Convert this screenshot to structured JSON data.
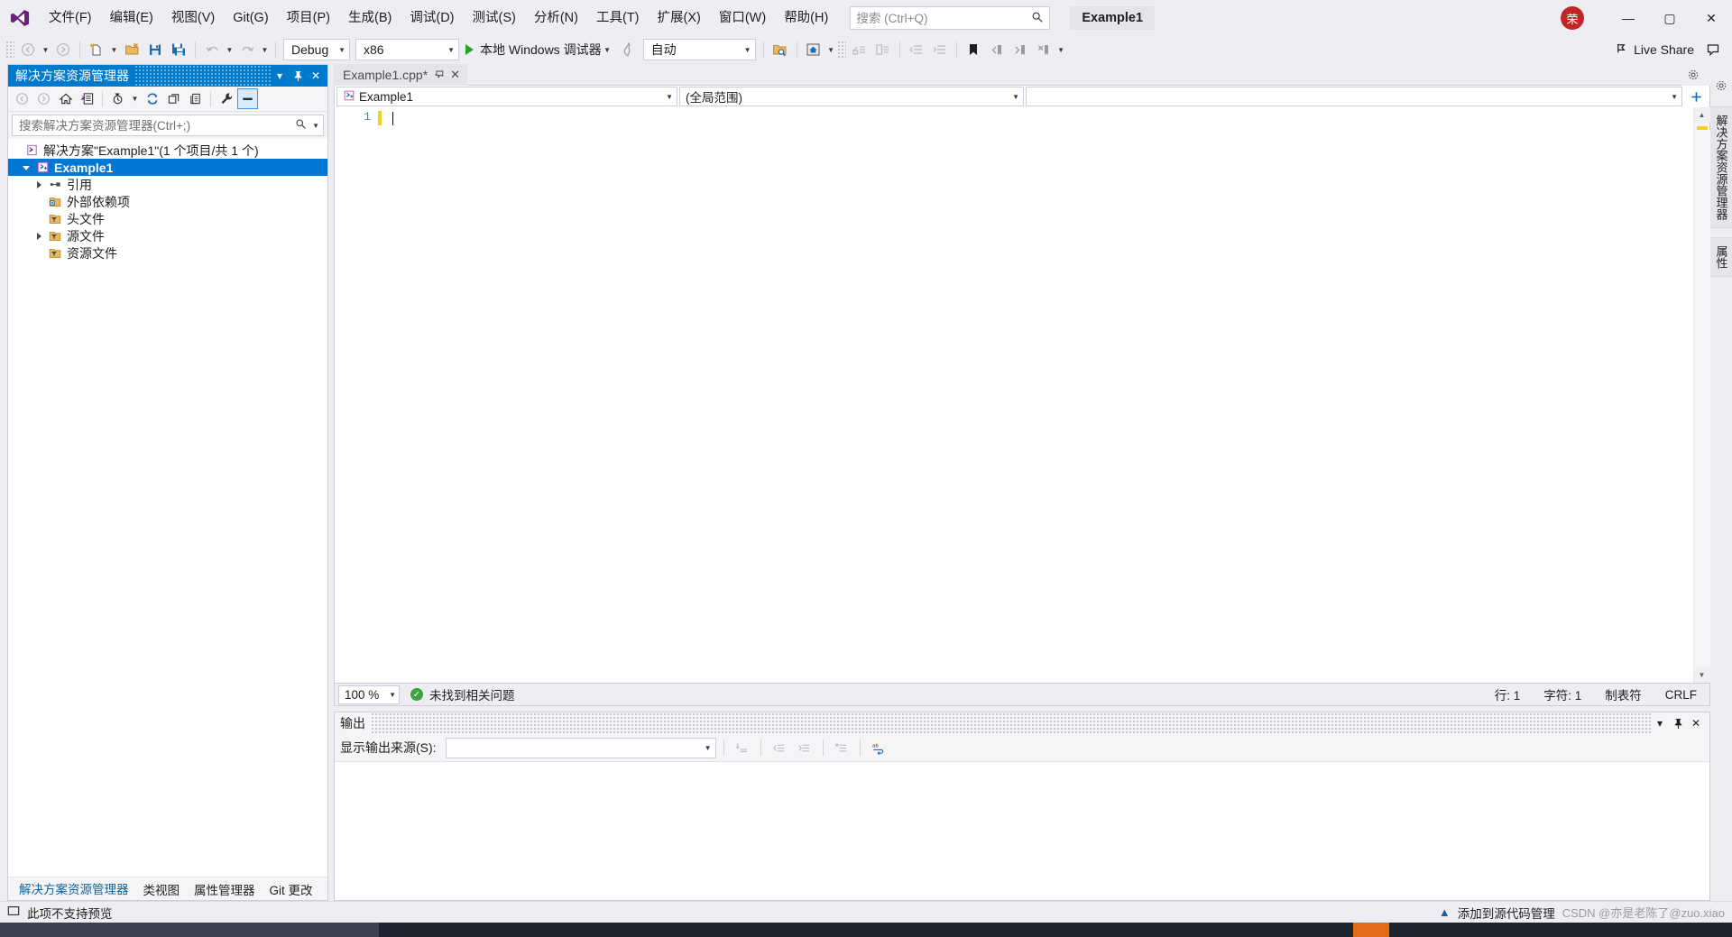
{
  "app": {
    "logo_icon": "visual-studio-logo",
    "title_chip": "Example1"
  },
  "menu": {
    "items": [
      {
        "label": "文件(F)"
      },
      {
        "label": "编辑(E)"
      },
      {
        "label": "视图(V)"
      },
      {
        "label": "Git(G)"
      },
      {
        "label": "项目(P)"
      },
      {
        "label": "生成(B)"
      },
      {
        "label": "调试(D)"
      },
      {
        "label": "测试(S)"
      },
      {
        "label": "分析(N)"
      },
      {
        "label": "工具(T)"
      },
      {
        "label": "扩展(X)"
      },
      {
        "label": "窗口(W)"
      },
      {
        "label": "帮助(H)"
      }
    ]
  },
  "search": {
    "placeholder": "搜索 (Ctrl+Q)",
    "value": "",
    "icon": "search-icon"
  },
  "account": {
    "initial": "荣"
  },
  "window_controls": {
    "minimize": "—",
    "maximize": "▢",
    "close": "✕"
  },
  "toolbar": {
    "nav_back_icon": "arrow-back-icon",
    "nav_forward_icon": "arrow-forward-icon",
    "new_item_icon": "new-file-icon",
    "open_icon": "open-folder-icon",
    "save_icon": "save-icon",
    "save_all_icon": "save-all-icon",
    "undo_icon": "undo-icon",
    "redo_icon": "redo-icon",
    "configuration": "Debug",
    "platform": "x86",
    "run_label": "本地 Windows 调试器",
    "run_icon": "play-icon",
    "hot_reload_icon": "hot-reload-icon",
    "process_value": "自动",
    "find_in_files_icon": "find-in-files-icon",
    "solution_home_icon": "solution-home-icon",
    "comment_icon": "comment-selection-icon",
    "uncomment_icon": "uncomment-selection-icon",
    "outdent_icon": "decrease-indent-icon",
    "indent_icon": "increase-indent-icon",
    "bookmark_icon": "bookmark-icon",
    "prev_bookmark_icon": "previous-bookmark-icon",
    "next_bookmark_icon": "next-bookmark-icon",
    "clear_bookmarks_icon": "clear-bookmarks-icon",
    "overflow_icon": "toolbar-overflow-icon",
    "live_share_label": "Live Share",
    "live_share_icon": "live-share-icon",
    "feedback_icon": "feedback-icon"
  },
  "solution_explorer": {
    "title": "解决方案资源管理器",
    "title_buttons": {
      "dropdown": "▾",
      "pin": "pin-icon",
      "close": "✕"
    },
    "toolbar": {
      "back_icon": "back-icon",
      "forward_icon": "forward-icon",
      "home_icon": "home-icon",
      "solution_view_icon": "solution-view-icon",
      "pending_changes_icon": "pending-changes-filter-icon",
      "refresh_icon": "refresh-icon",
      "collapse_all_icon": "collapse-all-icon",
      "show_all_files_icon": "show-all-files-icon",
      "properties_icon": "properties-wrench-icon",
      "preview_icon": "preview-selected-items-icon"
    },
    "search": {
      "placeholder": "搜索解决方案资源管理器(Ctrl+;)",
      "value": "",
      "icon": "search-icon"
    },
    "tree": [
      {
        "label": "解决方案\"Example1\"(1 个项目/共 1 个)",
        "icon": "solution-icon",
        "indent": 0,
        "expander": "none",
        "selected": false,
        "bold": false
      },
      {
        "label": "Example1",
        "icon": "cpp-project-icon",
        "indent": 1,
        "expander": "expanded",
        "selected": true,
        "bold": true
      },
      {
        "label": "引用",
        "icon": "references-icon",
        "indent": 2,
        "expander": "collapsed",
        "selected": false,
        "bold": false
      },
      {
        "label": "外部依赖项",
        "icon": "external-dependencies-icon",
        "indent": 2,
        "expander": "none",
        "selected": false,
        "bold": false
      },
      {
        "label": "头文件",
        "icon": "filter-folder-icon",
        "indent": 2,
        "expander": "none",
        "selected": false,
        "bold": false
      },
      {
        "label": "源文件",
        "icon": "filter-folder-icon",
        "indent": 2,
        "expander": "collapsed",
        "selected": false,
        "bold": false
      },
      {
        "label": "资源文件",
        "icon": "filter-folder-icon",
        "indent": 2,
        "expander": "none",
        "selected": false,
        "bold": false
      }
    ],
    "bottom_tabs": [
      {
        "label": "解决方案资源管理器",
        "active": true
      },
      {
        "label": "类视图",
        "active": false
      },
      {
        "label": "属性管理器",
        "active": false
      },
      {
        "label": "Git 更改",
        "active": false
      }
    ]
  },
  "editor": {
    "tab": {
      "label": "Example1.cpp*",
      "pin_icon": "pin-icon",
      "close_icon": "close-icon"
    },
    "navbar": {
      "project": "Example1",
      "project_icon": "cpp-project-icon",
      "scope": "(全局范围)",
      "member": "",
      "add_icon": "add-icon"
    },
    "lines": [
      {
        "number": "1",
        "text": ""
      }
    ],
    "status": {
      "zoom": "100 %",
      "issues_icon": "ok-check-icon",
      "issues_text": "未找到相关问题",
      "line": "行: 1",
      "column": "字符: 1",
      "indent_mode": "制表符",
      "line_ending": "CRLF"
    },
    "settings_icon": "gear-icon"
  },
  "output": {
    "title": "输出",
    "source_label": "显示输出来源(S):",
    "source_value": "",
    "title_buttons": {
      "dropdown": "▾",
      "pin": "pin-icon",
      "close": "✕"
    },
    "toolbar_icons": [
      "go-to-message-icon",
      "previous-message-icon",
      "next-message-icon",
      "clear-all-icon",
      "word-wrap-icon"
    ],
    "body_text": ""
  },
  "right_dock": {
    "tabs": [
      {
        "label": "解决方案资源管理器"
      },
      {
        "label": "属性"
      }
    ]
  },
  "statusbar": {
    "preview_icon": "preview-icon",
    "preview_text": "此项不支持预览",
    "up_icon": "add-to-source-control-icon",
    "right_text": "添加到源代码管理",
    "watermark": "CSDN @亦是老陈了@zuo.xiao"
  },
  "colors": {
    "accent_blue": "#007acc",
    "selection_blue": "#0078d4",
    "titlebar_bg": "#eeeef2",
    "editor_bg": "#ffffff",
    "change_marker": "#f2d024",
    "ok_green": "#3fa13f",
    "account_red": "#c02626"
  }
}
